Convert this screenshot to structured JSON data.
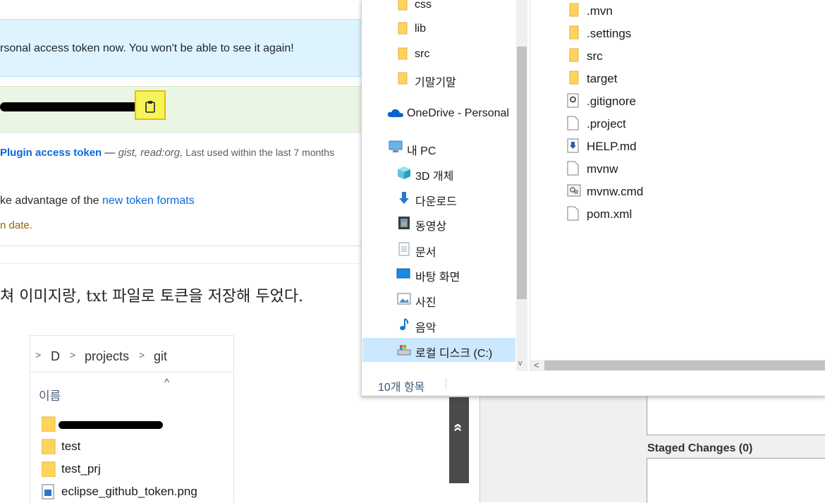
{
  "web": {
    "flash_message": "rsonal access token now. You won't be able to see it again!",
    "token_name": "Plugin access token",
    "token_dash": " — ",
    "token_scopes": "gist, read:org,",
    "token_last_used": " Last used within the last 7 months",
    "advantage_prefix": "ke advantage of the ",
    "advantage_link": "new token formats",
    "date_text": "n date.",
    "blog_text": "쳐 이미지랑, txt 파일로 토큰을 저장해 두었다.",
    "scroll_top_glyph": "»"
  },
  "embedded_explorer": {
    "breadcrumb": [
      ">",
      "D",
      ">",
      "projects",
      ">",
      "git"
    ],
    "column_header": "이름",
    "sort_glyph": "^",
    "rows": [
      {
        "name": "test",
        "icon": "folder-icon"
      },
      {
        "name": "test_prj",
        "icon": "folder-icon"
      },
      {
        "name": "eclipse_github_token.png",
        "icon": "image-file-icon"
      }
    ]
  },
  "explorer": {
    "nav_items": [
      {
        "label": "css",
        "icon": "folder-icon"
      },
      {
        "label": "lib",
        "icon": "folder-icon"
      },
      {
        "label": "src",
        "icon": "folder-icon"
      },
      {
        "label": "기말기말",
        "icon": "folder-icon"
      },
      {
        "label": "OneDrive - Personal",
        "icon": "onedrive-icon"
      },
      {
        "label": "내 PC",
        "icon": "pc-icon"
      },
      {
        "label": "3D 개체",
        "icon": "3d-objects-icon"
      },
      {
        "label": "다운로드",
        "icon": "download-icon"
      },
      {
        "label": "동영상",
        "icon": "videos-icon"
      },
      {
        "label": "문서",
        "icon": "documents-icon"
      },
      {
        "label": "바탕 화면",
        "icon": "desktop-icon"
      },
      {
        "label": "사진",
        "icon": "pictures-icon"
      },
      {
        "label": "음악",
        "icon": "music-icon"
      },
      {
        "label": "로컬 디스크 (C:)",
        "icon": "local-disk-icon"
      }
    ],
    "files": [
      {
        "name": ".mvn",
        "icon": "folder-icon"
      },
      {
        "name": ".settings",
        "icon": "folder-icon"
      },
      {
        "name": "src",
        "icon": "folder-icon"
      },
      {
        "name": "target",
        "icon": "folder-icon"
      },
      {
        "name": ".gitignore",
        "icon": "settings-file-icon"
      },
      {
        "name": ".project",
        "icon": "file-icon"
      },
      {
        "name": "HELP.md",
        "icon": "markdown-file-icon"
      },
      {
        "name": "mvnw",
        "icon": "file-icon"
      },
      {
        "name": "mvnw.cmd",
        "icon": "cmd-file-icon"
      },
      {
        "name": "pom.xml",
        "icon": "file-icon"
      }
    ],
    "status_count": "10개 항목",
    "scroll_down_glyph": "v",
    "scroll_left_glyph": "<"
  },
  "ide": {
    "staged_changes_label": "Staged Changes (0)"
  },
  "colors": {
    "link": "#0969da",
    "flash_bg": "#ddf4ff",
    "highlight": "#f7f35a",
    "nav_selected": "#cce8ff",
    "folder": "#ffd35c"
  }
}
